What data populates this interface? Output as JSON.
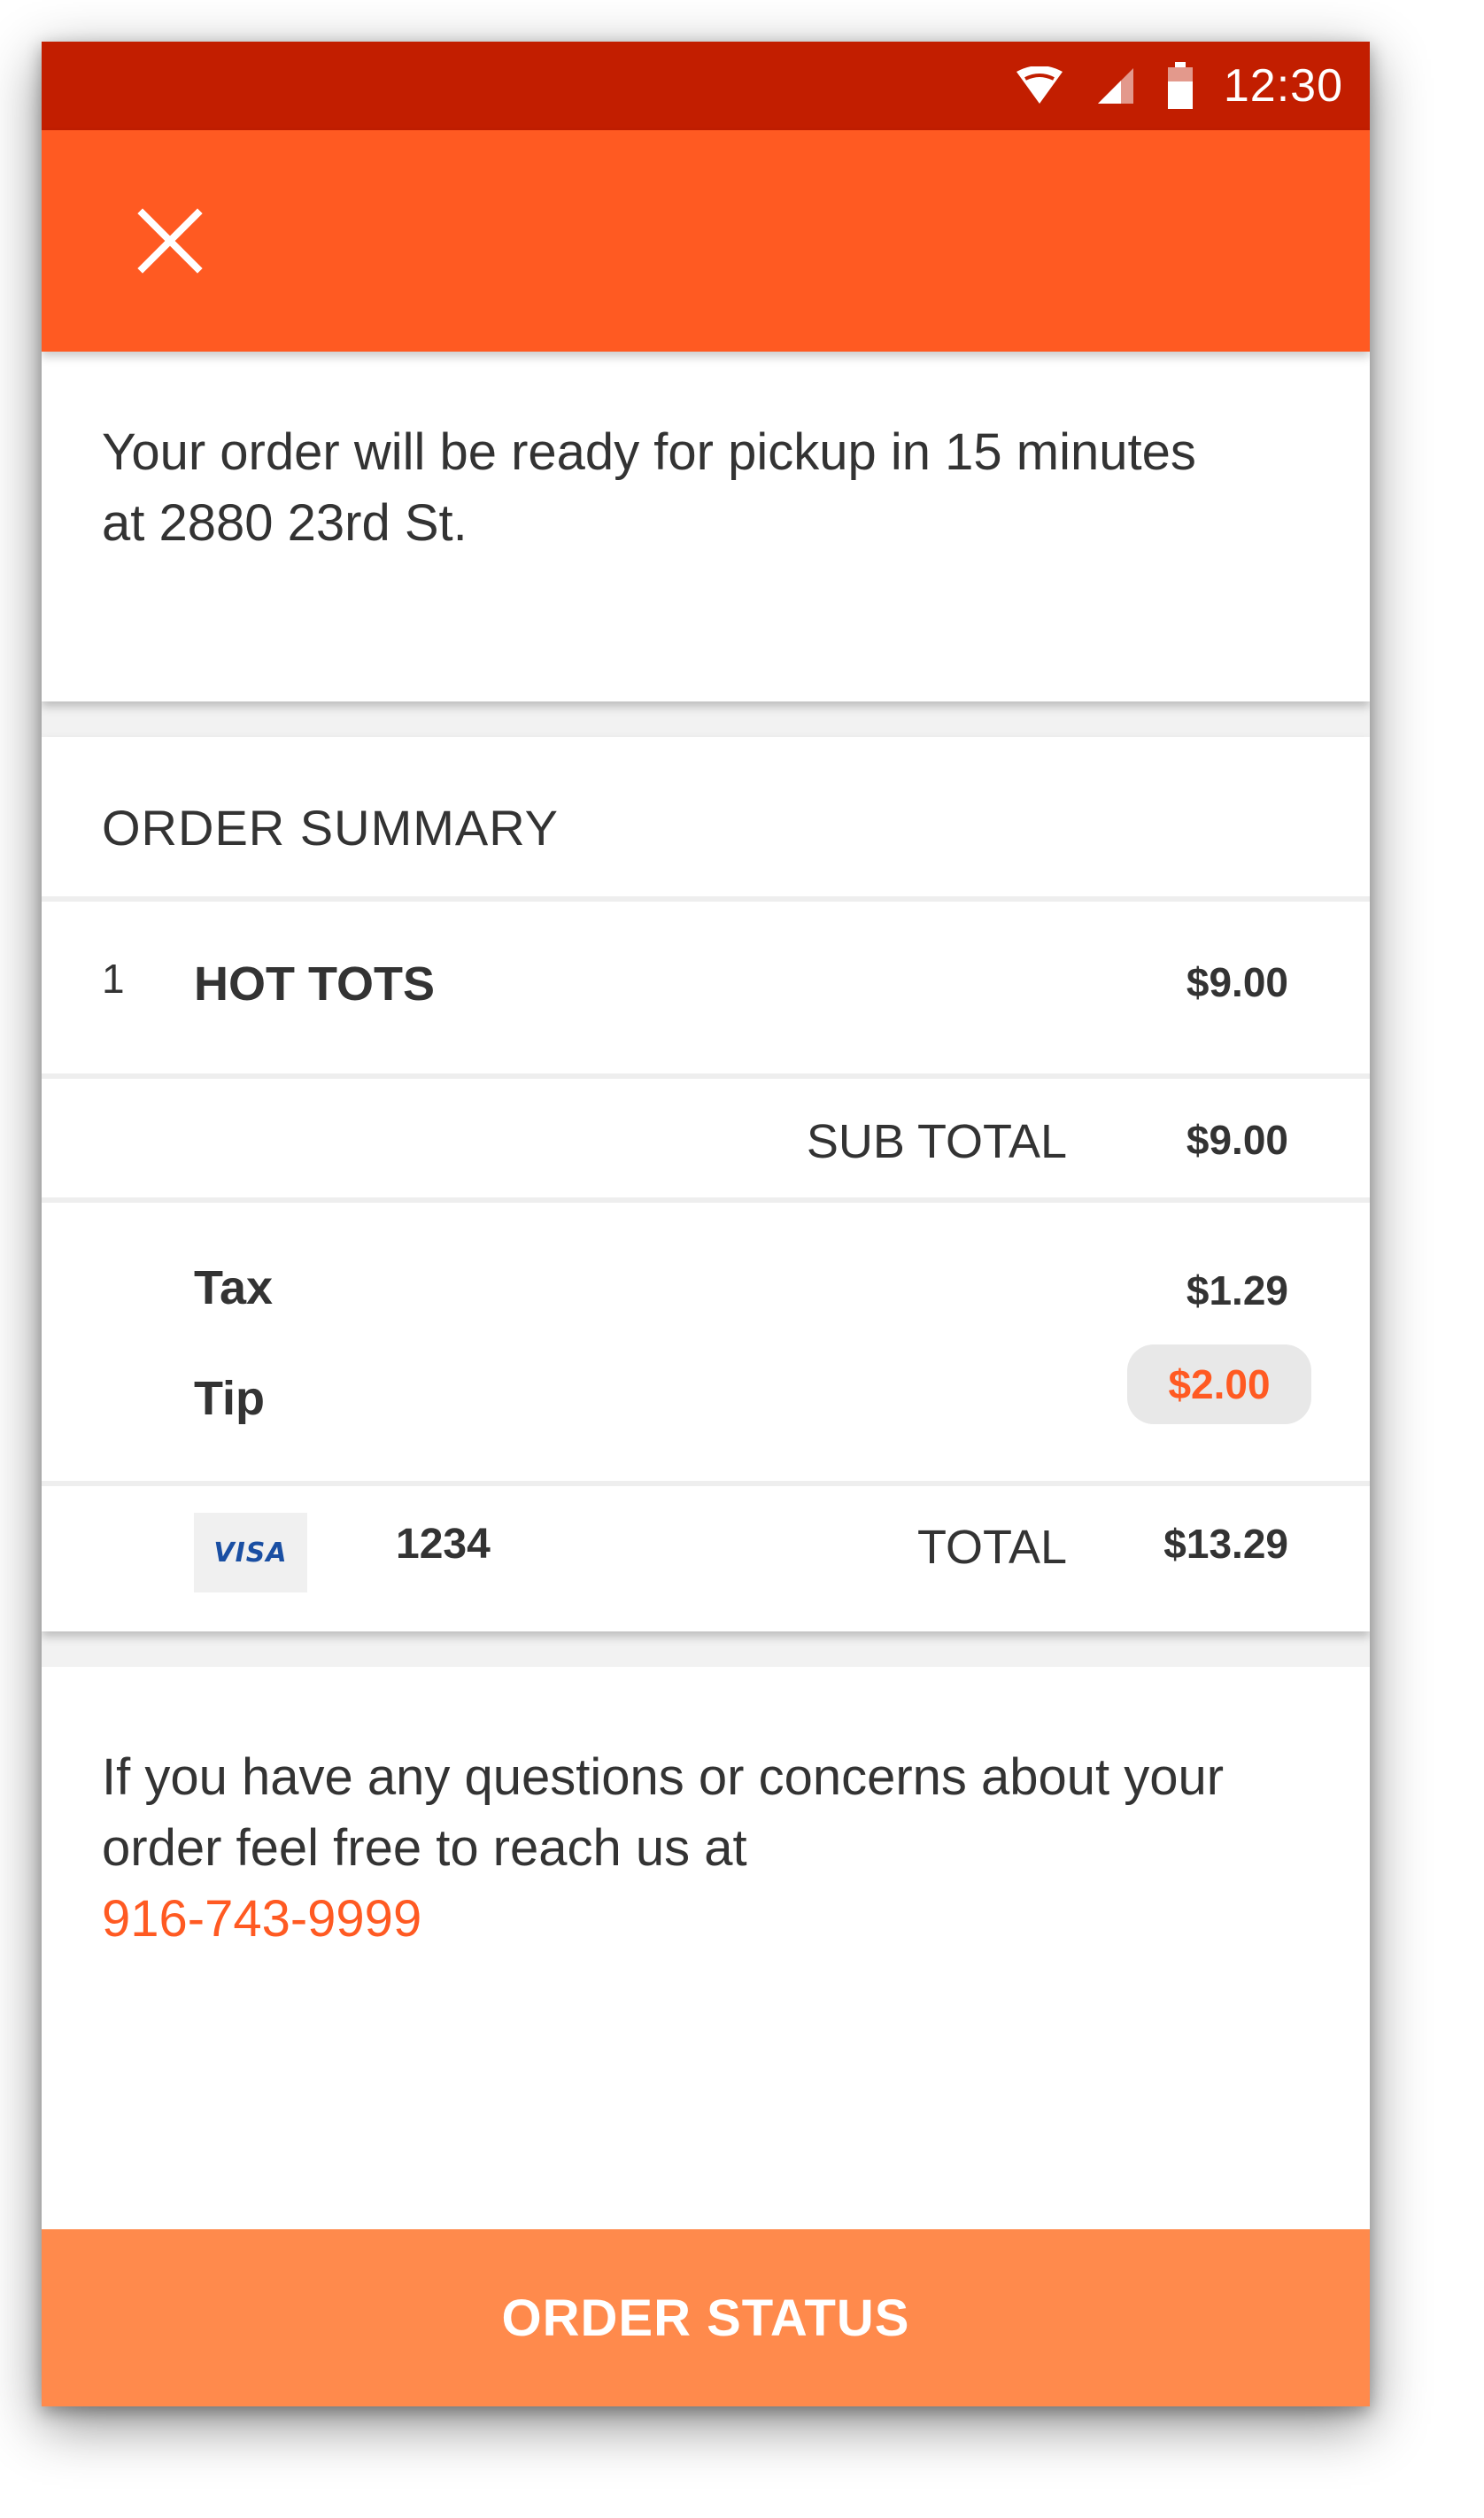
{
  "status_bar": {
    "time": "12:30",
    "icons": [
      "wifi-icon",
      "signal-icon",
      "battery-icon"
    ]
  },
  "app_bar": {
    "close_icon": "close-icon"
  },
  "pickup": {
    "message": "Your order will be ready for pickup in 15 minutes at 2880 23rd St."
  },
  "order_summary": {
    "header": "ORDER SUMMARY",
    "items": [
      {
        "qty": "1",
        "name": "HOT TOTS",
        "price": "$9.00"
      }
    ],
    "subtotal_label": "SUB TOTAL",
    "subtotal": "$9.00",
    "tax_label": "Tax",
    "tax": "$1.29",
    "tip_label": "Tip",
    "tip": "$2.00",
    "card_brand": "VISA",
    "card_last4": "1234",
    "total_label": "TOTAL",
    "total": "$13.29"
  },
  "contact": {
    "message": "If you have any questions or concerns about your order feel free to reach us at",
    "phone": "916-743-9999"
  },
  "footer": {
    "button_label": "ORDER STATUS"
  },
  "colors": {
    "status_bar": "#c21e00",
    "app_bar": "#ff5a22",
    "accent": "#ff5a22",
    "button": "#ff8a4c",
    "visa_blue": "#1a4fa3"
  }
}
